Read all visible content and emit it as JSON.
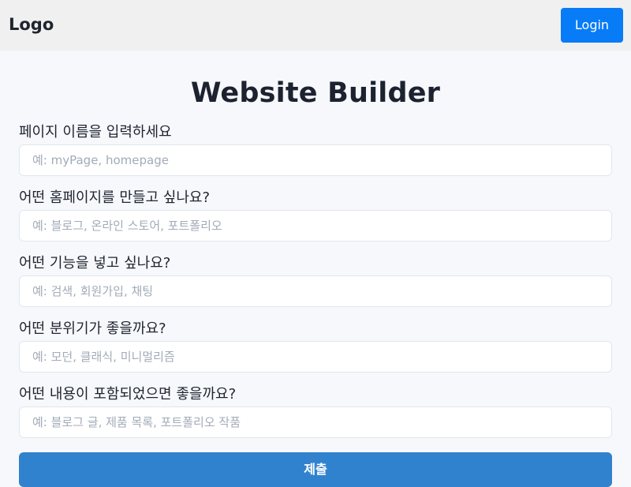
{
  "header": {
    "logo": "Logo",
    "login_label": "Login"
  },
  "main": {
    "title": "Website Builder",
    "fields": [
      {
        "label": "페이지 이름을 입력하세요",
        "placeholder": "예: myPage, homepage",
        "value": ""
      },
      {
        "label": "어떤 홈페이지를 만들고 싶나요?",
        "placeholder": "예: 블로그, 온라인 스토어, 포트폴리오",
        "value": ""
      },
      {
        "label": "어떤 기능을 넣고 싶나요?",
        "placeholder": "예: 검색, 회원가입, 채팅",
        "value": ""
      },
      {
        "label": "어떤 분위기가 좋을까요?",
        "placeholder": "예: 모던, 클래식, 미니멀리즘",
        "value": ""
      },
      {
        "label": "어떤 내용이 포함되었으면 좋을까요?",
        "placeholder": "예: 블로그 글, 제품 목록, 포트폴리오 작품",
        "value": ""
      }
    ],
    "submit_label": "제출"
  },
  "colors": {
    "header_bg": "#f1f0f0",
    "login_button": "#087cf6",
    "submit_button": "#3182ce",
    "page_bg": "#f6f8fb"
  }
}
